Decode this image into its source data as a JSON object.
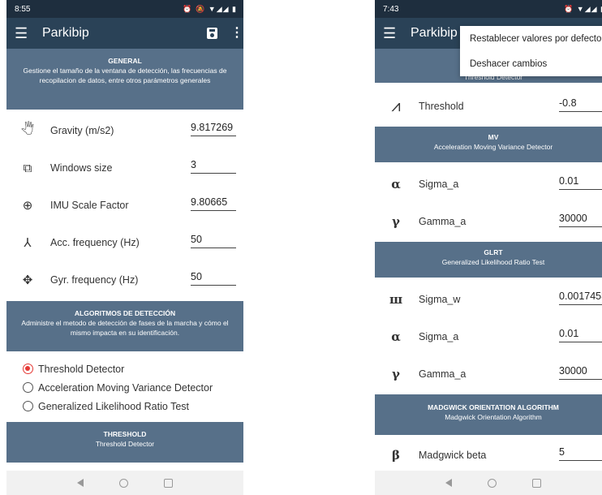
{
  "left": {
    "status": {
      "time": "8:55",
      "icons": "⏰ 🔕 ▼◢◢ ▮"
    },
    "appbar": {
      "title": "Parkibip",
      "menu_icon": "☰",
      "more_icon": "⋮"
    },
    "general": {
      "title": "GENERAL",
      "description": "Gestione el tamaño de la ventana de detección, las frecuencias de recopilacion de datos, entre otros parámetros generales"
    },
    "settings": [
      {
        "icon": "🖑",
        "label": "Gravity (m/s2)",
        "value": "9.817269"
      },
      {
        "icon": "⧉",
        "label": "Windows size",
        "value": "3"
      },
      {
        "icon": "⊕",
        "label": "IMU Scale Factor",
        "value": "9.80665"
      },
      {
        "icon": "⅄",
        "label": "Acc. frequency (Hz)",
        "value": "50"
      },
      {
        "icon": "✥",
        "label": "Gyr. frequency (Hz)",
        "value": "50"
      }
    ],
    "algorithms": {
      "title": "ALGORITMOS DE DETECCIÓN",
      "description": "Administre el metodo de detección de fases de la marcha y cómo el mismo impacta en su identificación."
    },
    "radios": [
      {
        "label": "Threshold Detector",
        "checked": true
      },
      {
        "label": "Acceleration Moving Variance Detector",
        "checked": false
      },
      {
        "label": "Generalized Likelihood Ratio Test",
        "checked": false
      }
    ],
    "threshold": {
      "title": "THRESHOLD",
      "description": "Threshold Detector"
    }
  },
  "right": {
    "status": {
      "time": "7:43",
      "icons": "⏰ ▼◢◢ ▮"
    },
    "appbar": {
      "title": "Parkibip",
      "menu_icon": "☰"
    },
    "menu": {
      "item1": "Restablecer valores por defecto",
      "item2": "Deshacer cambios"
    },
    "threshold_header_hidden": "Threshold Detector",
    "threshold_row": {
      "icon": "⩘",
      "label": "Threshold",
      "value": "-0.8"
    },
    "mv": {
      "title": "MV",
      "description": "Acceleration Moving Variance Detector"
    },
    "mv_rows": [
      {
        "icon": "α",
        "label": "Sigma_a",
        "value": "0.01"
      },
      {
        "icon": "γ",
        "label": "Gamma_a",
        "value": "30000"
      }
    ],
    "glrt": {
      "title": "GLRT",
      "description": "Generalized Likelihood Ratio Test"
    },
    "glrt_rows": [
      {
        "icon": "ш",
        "label": "Sigma_w",
        "value": "0.0017453"
      },
      {
        "icon": "α",
        "label": "Sigma_a",
        "value": "0.01"
      },
      {
        "icon": "γ",
        "label": "Gamma_a",
        "value": "30000"
      }
    ],
    "madgwick": {
      "title": "MADGWICK ORIENTATION ALGORITHM",
      "description": "Madgwick Orientation Algorithm"
    },
    "madgwick_row": {
      "icon": "β",
      "label": "Madgwick beta",
      "value": "5"
    }
  },
  "colors": {
    "statusbar": "#1e2e3e",
    "appbar": "#2a4257",
    "section": "#577089",
    "radio_accent": "#e53935"
  }
}
